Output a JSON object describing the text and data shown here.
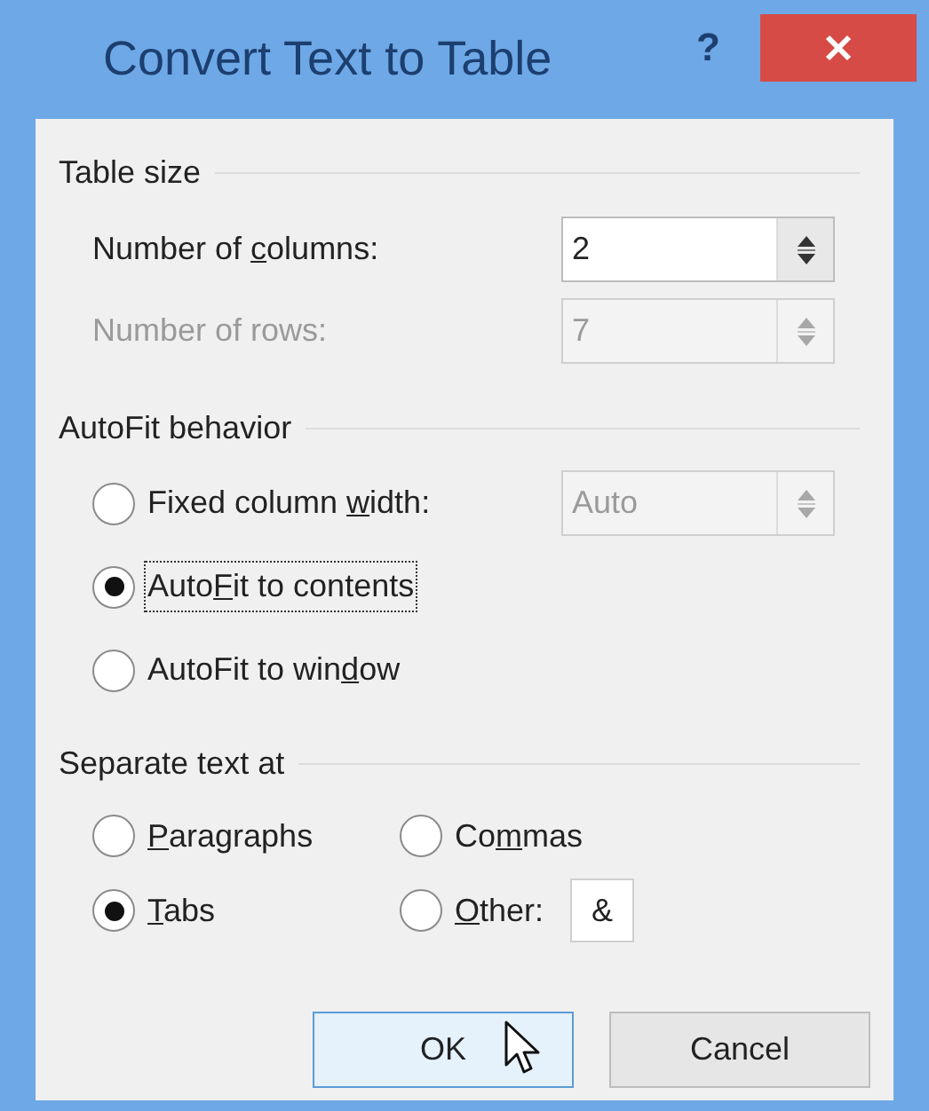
{
  "window": {
    "title": "Convert Text to Table",
    "help": "?"
  },
  "table_size": {
    "heading": "Table size",
    "fields": [
      {
        "label": {
          "before": "Number of ",
          "key": "c",
          "after": "olumns:"
        },
        "value": "2",
        "disabled": false
      },
      {
        "label": {
          "before": "Number of rows:"
        },
        "value": "7",
        "disabled": true
      }
    ]
  },
  "autofit": {
    "heading": "AutoFit behavior",
    "options": [
      {
        "label": {
          "before": "Fixed column ",
          "key": "w",
          "after": "idth:"
        },
        "selected": false,
        "focused": false,
        "spinner": {
          "value": "Auto",
          "disabled": true
        }
      },
      {
        "label": {
          "before": "Auto",
          "key": "F",
          "after": "it to contents"
        },
        "selected": true,
        "focused": true
      },
      {
        "label": {
          "before": "AutoFit to win",
          "key": "d",
          "after": "ow"
        },
        "selected": false,
        "focused": false
      }
    ]
  },
  "separate": {
    "heading": "Separate text at",
    "options": [
      {
        "label": {
          "key": "P",
          "after": "aragraphs"
        },
        "selected": false
      },
      {
        "label": {
          "before": "Co",
          "key": "m",
          "after": "mas"
        },
        "selected": false
      },
      {
        "label": {
          "key": "T",
          "after": "abs"
        },
        "selected": true
      },
      {
        "label": {
          "key": "O",
          "after": "ther:"
        },
        "selected": false,
        "field": {
          "value": "&"
        }
      }
    ]
  },
  "buttons": [
    {
      "label": "OK",
      "default": true
    },
    {
      "label": "Cancel",
      "default": false
    }
  ]
}
